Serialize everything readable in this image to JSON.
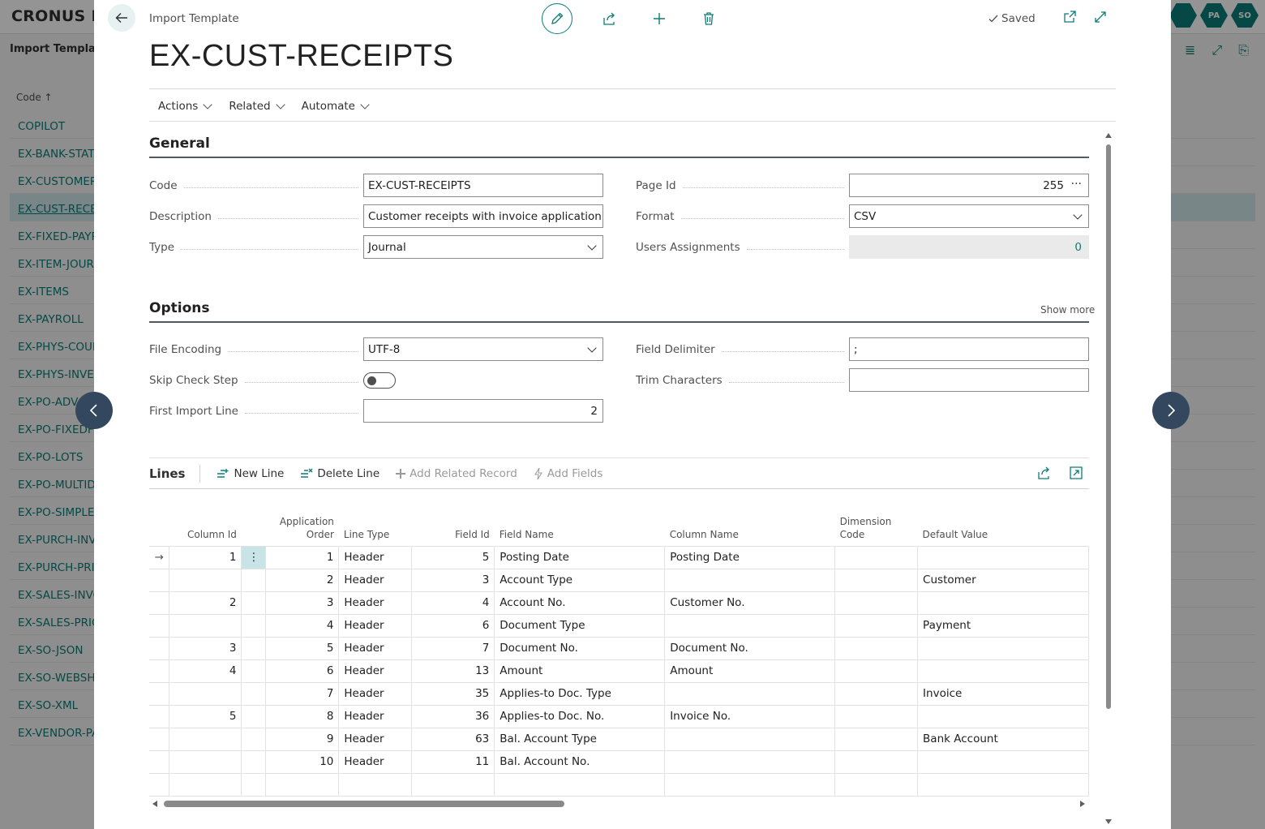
{
  "background": {
    "company": "CRONUS IT",
    "page_title": "Import Template",
    "badges": [
      "",
      "PA",
      "SO"
    ],
    "column_header": "Code ↑",
    "list": [
      "COPILOT",
      "EX-BANK-STATE",
      "EX-CUSTOMERS",
      "EX-CUST-RECEI",
      "EX-FIXED-PAYR",
      "EX-ITEM-JOURN",
      "EX-ITEMS",
      "EX-PAYROLL",
      "EX-PHYS-COUN",
      "EX-PHYS-INVEN",
      "EX-PO-ADV",
      "EX-PO-FIXEDF",
      "EX-PO-LOTS",
      "EX-PO-MULTID",
      "EX-PO-SIMPLE",
      "EX-PURCH-INV",
      "EX-PURCH-PRIC",
      "EX-SALES-INVO",
      "EX-SALES-PRIC",
      "EX-SO-JSON",
      "EX-SO-WEBSHO",
      "EX-SO-XML",
      "EX-VENDOR-PA"
    ],
    "selected_index": 3
  },
  "dialog": {
    "breadcrumb": "Import Template",
    "title": "EX-CUST-RECEIPTS",
    "saved_label": "Saved",
    "menu": [
      "Actions",
      "Related",
      "Automate"
    ]
  },
  "general": {
    "heading": "General",
    "code_label": "Code",
    "code_value": "EX-CUST-RECEIPTS",
    "description_label": "Description",
    "description_value": "Customer receipts with invoice application (CSV)",
    "type_label": "Type",
    "type_value": "Journal",
    "page_id_label": "Page Id",
    "page_id_value": "255",
    "format_label": "Format",
    "format_value": "CSV",
    "users_label": "Users Assignments",
    "users_value": "0"
  },
  "options": {
    "heading": "Options",
    "show_more": "Show more",
    "encoding_label": "File Encoding",
    "encoding_value": "UTF-8",
    "skip_label": "Skip Check Step",
    "skip_value": false,
    "first_line_label": "First Import Line",
    "first_line_value": "2",
    "delimiter_label": "Field Delimiter",
    "delimiter_value": ";",
    "trim_label": "Trim Characters",
    "trim_value": ""
  },
  "lines": {
    "heading": "Lines",
    "new_line": "New Line",
    "delete_line": "Delete Line",
    "add_related": "Add Related Record",
    "add_fields": "Add Fields",
    "columns": [
      "Column Id",
      "Application Order",
      "Line Type",
      "Field Id",
      "Field Name",
      "Column Name",
      "Dimension Code",
      "Default Value"
    ],
    "rows": [
      {
        "column_id": "1",
        "order": "1",
        "type": "Header",
        "field_id": "5",
        "field_name": "Posting Date",
        "column_name": "Posting Date",
        "dimension": "",
        "default": ""
      },
      {
        "column_id": "",
        "order": "2",
        "type": "Header",
        "field_id": "3",
        "field_name": "Account Type",
        "column_name": "",
        "dimension": "",
        "default": "Customer"
      },
      {
        "column_id": "2",
        "order": "3",
        "type": "Header",
        "field_id": "4",
        "field_name": "Account No.",
        "column_name": "Customer No.",
        "dimension": "",
        "default": ""
      },
      {
        "column_id": "",
        "order": "4",
        "type": "Header",
        "field_id": "6",
        "field_name": "Document Type",
        "column_name": "",
        "dimension": "",
        "default": "Payment"
      },
      {
        "column_id": "3",
        "order": "5",
        "type": "Header",
        "field_id": "7",
        "field_name": "Document No.",
        "column_name": "Document No.",
        "dimension": "",
        "default": ""
      },
      {
        "column_id": "4",
        "order": "6",
        "type": "Header",
        "field_id": "13",
        "field_name": "Amount",
        "column_name": "Amount",
        "dimension": "",
        "default": ""
      },
      {
        "column_id": "",
        "order": "7",
        "type": "Header",
        "field_id": "35",
        "field_name": "Applies-to Doc. Type",
        "column_name": "",
        "dimension": "",
        "default": "Invoice"
      },
      {
        "column_id": "5",
        "order": "8",
        "type": "Header",
        "field_id": "36",
        "field_name": "Applies-to Doc. No.",
        "column_name": "Invoice No.",
        "dimension": "",
        "default": ""
      },
      {
        "column_id": "",
        "order": "9",
        "type": "Header",
        "field_id": "63",
        "field_name": "Bal. Account Type",
        "column_name": "",
        "dimension": "",
        "default": "Bank Account"
      },
      {
        "column_id": "",
        "order": "10",
        "type": "Header",
        "field_id": "11",
        "field_name": "Bal. Account No.",
        "column_name": "",
        "dimension": "",
        "default": ""
      },
      {
        "column_id": "",
        "order": "",
        "type": "",
        "field_id": "",
        "field_name": "",
        "column_name": "",
        "dimension": "",
        "default": ""
      }
    ]
  }
}
